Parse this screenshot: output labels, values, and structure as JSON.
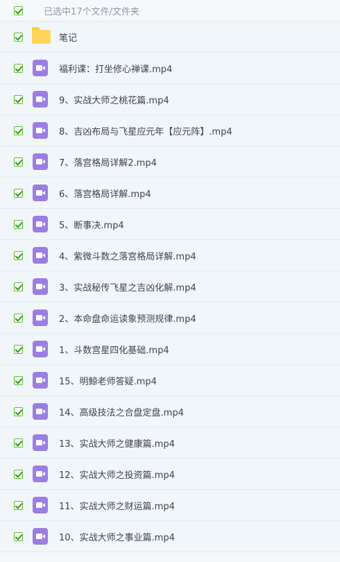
{
  "header": {
    "selection_text": "已选中17个文件/文件夹"
  },
  "rows": [
    {
      "name": "笔记",
      "type": "folder",
      "checked": true
    },
    {
      "name": "福利课：打坐修心禅课.mp4",
      "type": "video",
      "checked": true
    },
    {
      "name": "9、实战大师之桃花篇.mp4",
      "type": "video",
      "checked": true
    },
    {
      "name": "8、吉凶布局与飞星应元年【应元阵】.mp4",
      "type": "video",
      "checked": true
    },
    {
      "name": "7、落宫格局详解2.mp4",
      "type": "video",
      "checked": true
    },
    {
      "name": "6、落宫格局详解.mp4",
      "type": "video",
      "checked": true
    },
    {
      "name": "5、断事决.mp4",
      "type": "video",
      "checked": true
    },
    {
      "name": "4、紫微斗数之落宫格局详解.mp4",
      "type": "video",
      "checked": true
    },
    {
      "name": "3、实战秘传飞星之吉凶化解.mp4",
      "type": "video",
      "checked": true
    },
    {
      "name": "2、本命盘命运读象预测规律.mp4",
      "type": "video",
      "checked": true
    },
    {
      "name": "1、斗数宫星四化基础.mp4",
      "type": "video",
      "checked": true
    },
    {
      "name": "15、明鯨老师答疑.mp4",
      "type": "video",
      "checked": true
    },
    {
      "name": "14、高级技法之合盘定盘.mp4",
      "type": "video",
      "checked": true
    },
    {
      "name": "13、实战大师之健康篇.mp4",
      "type": "video",
      "checked": true
    },
    {
      "name": "12、实战大师之投资篇.mp4",
      "type": "video",
      "checked": true
    },
    {
      "name": "11、实战大师之财运篇.mp4",
      "type": "video",
      "checked": true
    },
    {
      "name": "10、实战大师之事业篇.mp4",
      "type": "video",
      "checked": true
    }
  ],
  "colors": {
    "checkbox_check": "#2f9c1b",
    "video_icon": "#9b7de3",
    "folder_icon": "#ffd65a",
    "row_background": "#f1f6fa"
  },
  "icons": {
    "folder": "folder-icon",
    "video": "video-file-icon",
    "checkbox": "checked-checkbox-icon"
  }
}
